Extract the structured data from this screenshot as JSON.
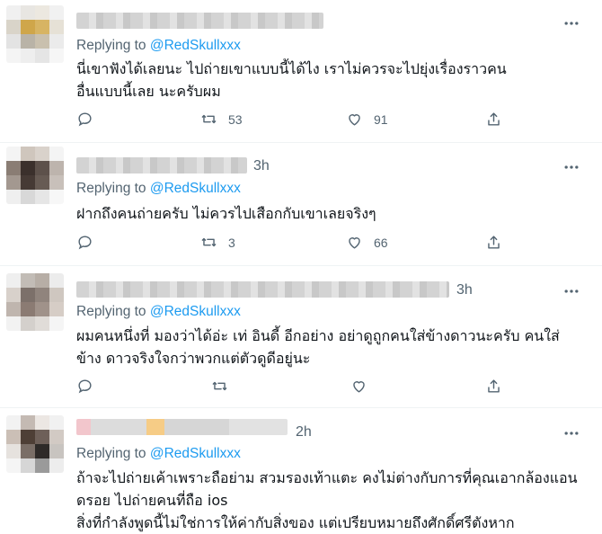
{
  "tweets": [
    {
      "time": "",
      "replying_prefix": "Replying to ",
      "handle": "@RedSkullxxx",
      "text": "นี่เขาฟังได้เลยนะ ไปถ่ายเขาแบบนี้ได้ไง เราไม่ควรจะไปยุ่งเรื่องราวคนอื่นแบบนี้เลย นะครับผม",
      "replies": "",
      "retweets": "53",
      "likes": "91"
    },
    {
      "time": "3h",
      "replying_prefix": "Replying to ",
      "handle": "@RedSkullxxx",
      "text": "ฝากถึงคนถ่ายครับ ไม่ควรไปเสือกกับเขาเลยจริงๆ",
      "replies": "",
      "retweets": "3",
      "likes": "66"
    },
    {
      "time": "3h",
      "replying_prefix": "Replying to ",
      "handle": "@RedSkullxxx",
      "text": "ผมคนหนึ่งที่ มองว่าได้อ่ะ เท่ อินดี้ อีกอย่าง อย่าดูถูกคนใส่ข้างดาวนะครับ คนใส่ข้าง ดาวจริงใจกว่าพวกแต่ตัวดูดีอยู่นะ",
      "replies": "",
      "retweets": "",
      "likes": ""
    },
    {
      "time": "2h",
      "replying_prefix": "Replying to ",
      "handle": "@RedSkullxxx",
      "text_lines": [
        "ถ้าจะไปถ่ายเค้าเพราะถือย่าม สวมรองเท้าแตะ คงไม่ต่างกับการที่คุณเอากล้องแอน",
        "ดรอย ไปถ่ายคนที่ถือ ios",
        "สิ่งที่กำลังพูดนี้ไม่ใช่การให้ค่ากับสิ่งของ แต่เปรียบหมายถึงศักดิ์ศรีตังหาก"
      ]
    }
  ],
  "icons": {
    "more": "more-icon",
    "reply": "reply-icon",
    "retweet": "retweet-icon",
    "like": "like-icon",
    "share": "share-icon"
  },
  "colors": {
    "link": "#1d9bf0",
    "muted": "#536471",
    "text": "#0f1419",
    "divider": "#eff3f4"
  }
}
